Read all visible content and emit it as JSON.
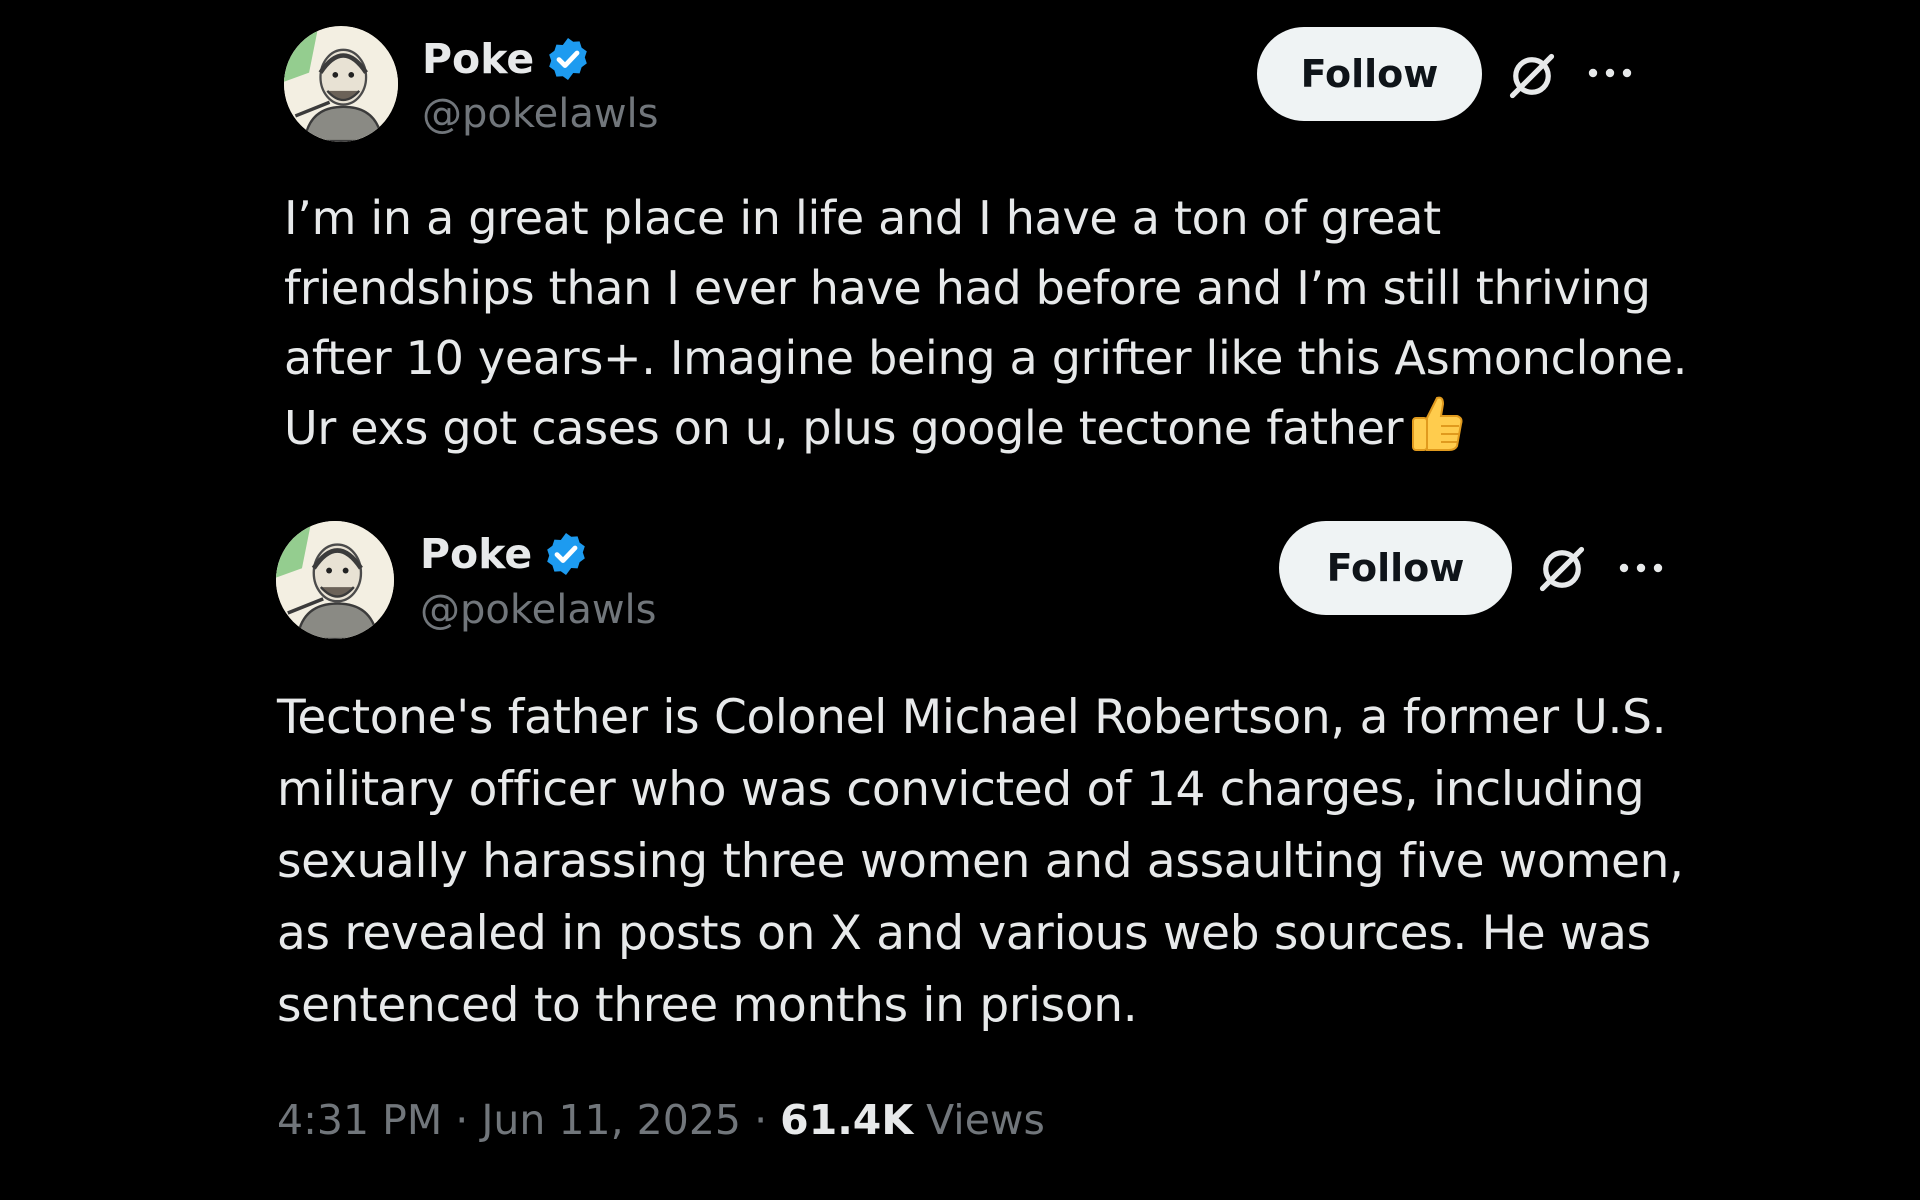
{
  "posts": [
    {
      "author": {
        "display_name": "Poke",
        "handle": "@pokelawls",
        "verified": true,
        "avatar_icon": "avatar-sketch-icon"
      },
      "follow_label": "Follow",
      "text_lines": [
        "I’m in a great place in life and I have a ton of great",
        "friendships than I ever have had before and I’m still thriving",
        "after 10 years+. Imagine being a grifter like this Asmonclone.",
        "Ur exs got cases on u, plus google tectone father"
      ],
      "emoji": "thumbs-up-icon"
    },
    {
      "author": {
        "display_name": "Poke",
        "handle": "@pokelawls",
        "verified": true,
        "avatar_icon": "avatar-sketch-icon"
      },
      "follow_label": "Follow",
      "text_lines": [
        "Tectone's father is Colonel Michael Robertson, a former U.S.",
        "military officer who was convicted of 14 charges, including",
        "sexually harassing three women and assaulting five women,",
        "as revealed in posts on X and various web sources. He was",
        "sentenced to three months in prison."
      ],
      "meta": {
        "time": "4:31 PM",
        "separator": "·",
        "date": "Jun 11, 2025",
        "views_count": "61.4K",
        "views_label": "Views"
      }
    }
  ],
  "colors": {
    "background": "#000000",
    "text_primary": "#e7e9ea",
    "text_secondary": "#71767b",
    "verified_badge": "#1d9bf0",
    "follow_bg": "#eff3f4",
    "follow_text": "#0f1419"
  }
}
